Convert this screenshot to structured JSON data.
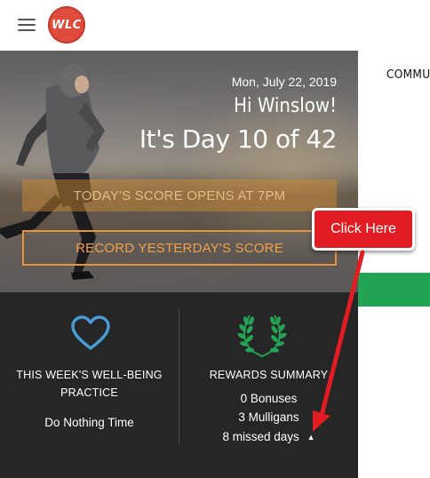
{
  "header": {
    "logo_text": "WLC"
  },
  "hero": {
    "date": "Mon, July 22, 2019",
    "greeting": "Hi Winslow!",
    "day_text": "It's Day 10 of 42",
    "today_button": "TODAY'S SCORE OPENS AT 7PM",
    "record_button": "RECORD YESTERDAY'S SCORE"
  },
  "wellbeing": {
    "title_line1": "THIS WEEK'S WELL-BEING",
    "title_line2": "PRACTICE",
    "practice": "Do Nothing Time"
  },
  "rewards": {
    "title": "REWARDS SUMMARY",
    "bonuses": "0 Bonuses",
    "mulligans": "3 Mulligans",
    "missed": "8 missed days"
  },
  "side_panel": {
    "heading": "COMMU"
  },
  "annotation": {
    "callout": "Click Here"
  },
  "colors": {
    "accent_orange": "#e8943a",
    "callout_red": "#e11c22",
    "heart_blue": "#4a9ad4",
    "laurel_green": "#23a455",
    "dark_panel": "#262626"
  },
  "icons": [
    "hamburger-menu-icon",
    "heart-icon",
    "laurel-wreath-icon",
    "caret-up-icon",
    "red-arrow"
  ]
}
